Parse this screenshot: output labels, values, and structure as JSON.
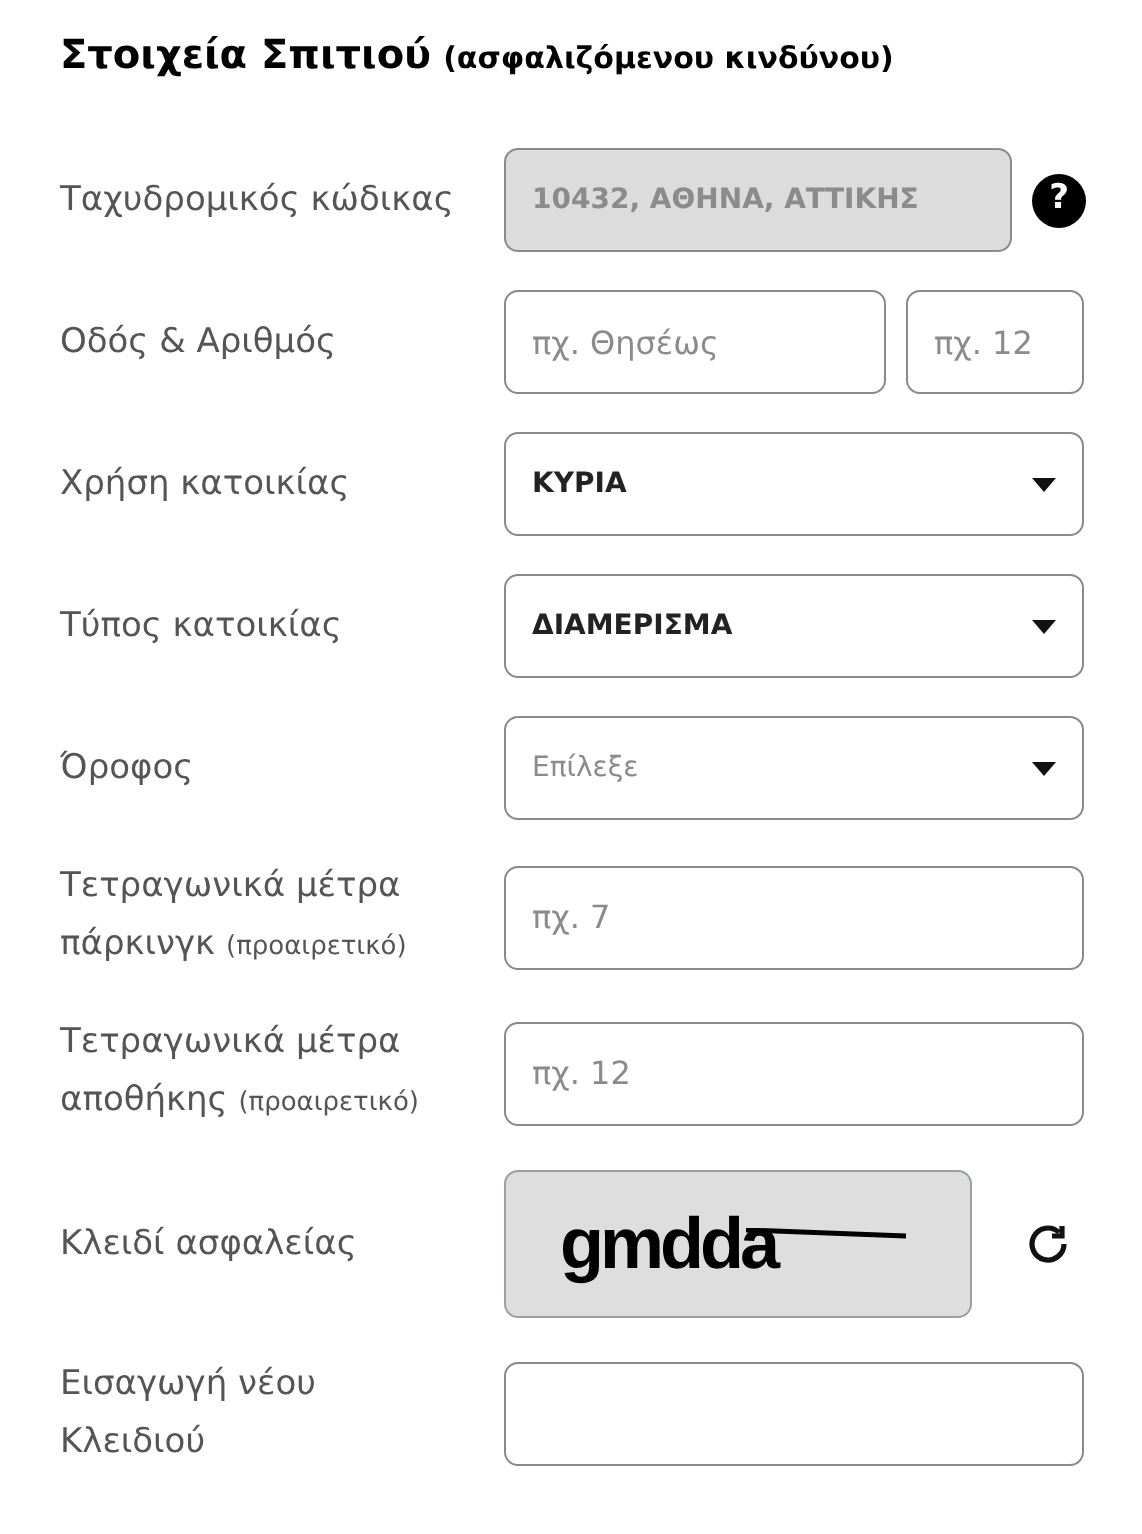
{
  "heading": {
    "title": "Στοιχεία Σπιτιού",
    "subtitle": "(ασφαλιζόμενου κινδύνου)"
  },
  "rows": [
    {
      "kind": "readonly",
      "label": "Ταχυδρομικός κώδικας",
      "value": "10432, ΑΘΗΝΑ, ΑΤΤΙΚΗΣ",
      "help": "?"
    },
    {
      "kind": "pair",
      "label": "Οδός & Αριθμός",
      "placeholder": "πχ. Θησέως",
      "placeholder_2": "πχ. 12"
    },
    {
      "kind": "select",
      "label": "Χρήση κατοικίας",
      "value": "ΚΥΡΙΑ"
    },
    {
      "kind": "select",
      "label": "Τύπος κατοικίας",
      "value": "ΔΙΑΜΕΡΙΣΜΑ"
    },
    {
      "kind": "select",
      "label": "Όροφος",
      "placeholder": "Επίλεξε"
    },
    {
      "kind": "text",
      "label": "Τετραγωνικά μέτρα πάρκινγκ",
      "note": "(προαιρετικό)",
      "placeholder": "πχ. 7"
    },
    {
      "kind": "text",
      "label": "Τετραγωνικά μέτρα αποθήκης",
      "note": "(προαιρετικό)",
      "placeholder": "πχ. 12"
    },
    {
      "kind": "captcha",
      "label": "Κλειδί ασφαλείας",
      "code": "gmdda"
    },
    {
      "kind": "text",
      "label": "Εισαγωγή νέου Κλειδιού"
    }
  ]
}
